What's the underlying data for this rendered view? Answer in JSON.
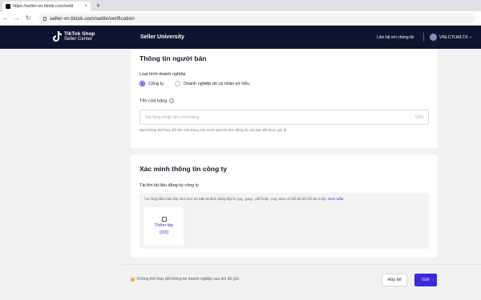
{
  "browser": {
    "tab_title": "https://seller-vn.tiktok.com/settl",
    "tab_close": "×",
    "new_tab": "+",
    "url": "seller-vn.tiktok.com/settle/verification",
    "back": "←",
    "forward": "→",
    "reload": "↻"
  },
  "header": {
    "logo_line1": "TikTok Shop",
    "logo_line2": "Seller Center",
    "nav_link": "Seller University",
    "contact": "Liên hệ với chúng tôi",
    "username": "VNLCTLWLTX",
    "caret": "⌄"
  },
  "seller_info": {
    "title": "Thông tin người bán",
    "business_type_label": "Loại hình doanh nghiệp",
    "options": [
      "Công ty",
      "Doanh nghiệp do cá nhân sở hữu"
    ],
    "selected_option": "Công ty",
    "shop_name_label": "Tên cửa hàng",
    "help_glyph": "?",
    "shop_name_placeholder": "Vui lòng nhập tên cửa hàng",
    "shop_name_value": "",
    "shop_name_counter": "0/20",
    "shop_name_hint": "Bạn không thể thay đổi tên cửa hàng của mình sau khi đơn đăng ký của bạn đã được gửi đi"
  },
  "company_verification": {
    "title": "Xác minh thông tin công ty",
    "upload_label": "Tải lên tài liệu đăng ký công ty",
    "upload_note": "Vui lòng đảm bảo tệp nhỏ hơn 10 MB và định dạng tệp là .jpg, .jpeg, .pdf hoặc .png. Bạn có thể tải lên tối đa 3 tệp.",
    "sample_link": "Xem mẫu",
    "add_file_label": "Thêm tệp",
    "add_file_count": "(0/3)"
  },
  "footer": {
    "warning": "Không thể thay đổi thông tin doanh nghiệp sau khi đã gửi.",
    "cancel_label": "Hủy bỏ",
    "submit_label": "Gửi"
  },
  "colors": {
    "accent": "#3c28de",
    "header_bg": "#0f1431",
    "warning": "#f5a623"
  }
}
